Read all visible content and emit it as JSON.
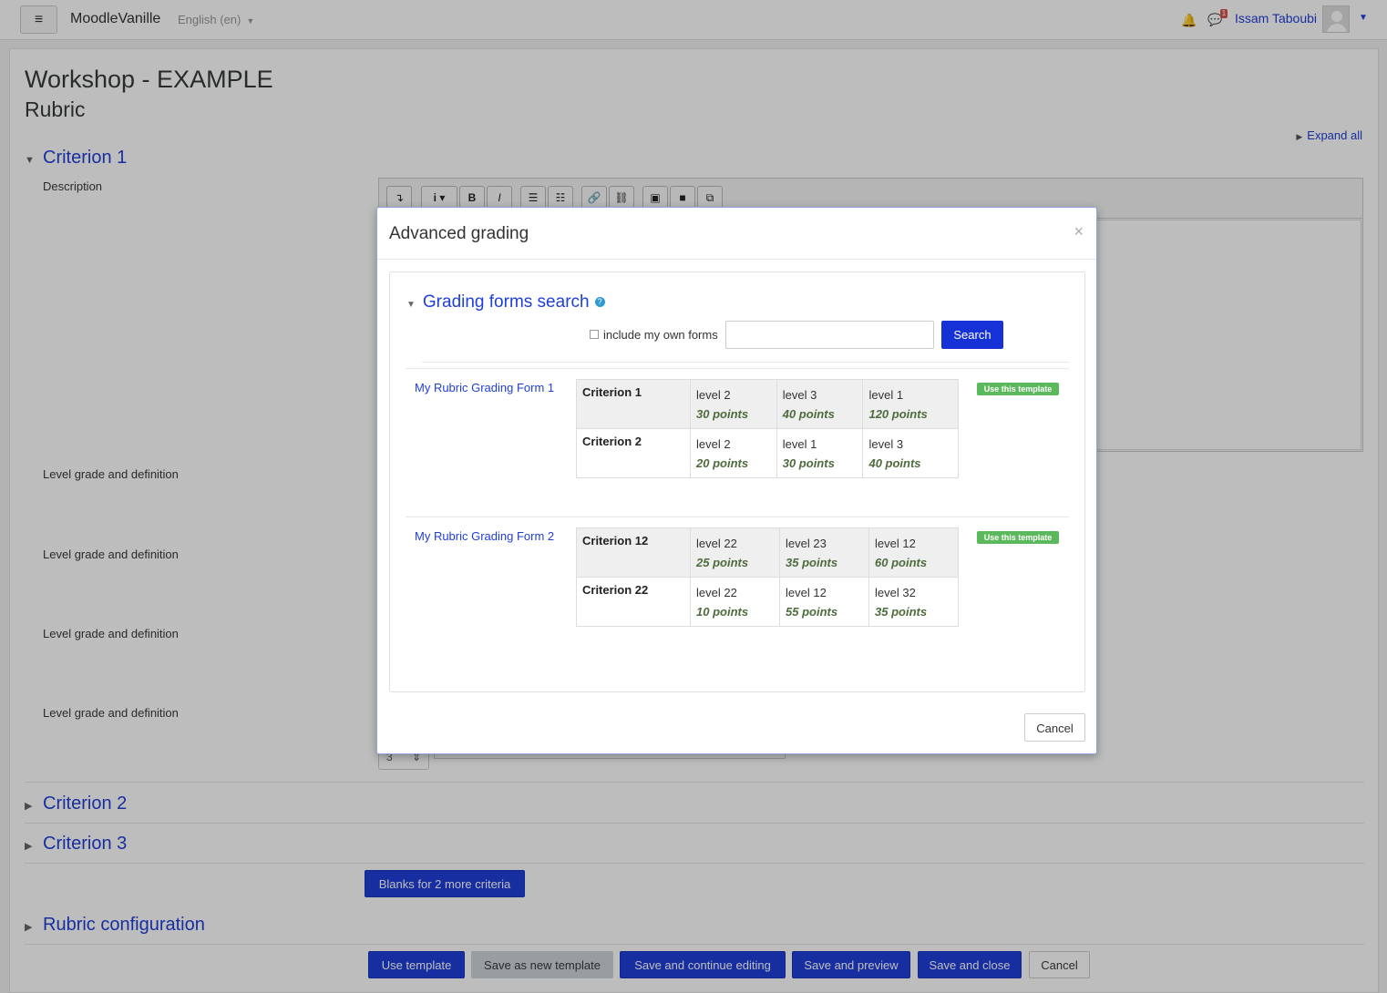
{
  "navbar": {
    "site_name": "MoodleVanille",
    "language": "English (en)",
    "user_name": "Issam Taboubi",
    "message_count": "1"
  },
  "page": {
    "title": "Workshop - EXAMPLE",
    "subtitle": "Rubric",
    "expand_all": "Expand all"
  },
  "criteria": {
    "c1": "Criterion 1",
    "c2": "Criterion 2",
    "c3": "Criterion 3",
    "description_label": "Description",
    "level_label": "Level grade and definition",
    "level_select_value": "3"
  },
  "rubric_config": "Rubric configuration",
  "buttons": {
    "blanks": "Blanks for 2 more criteria",
    "use_template": "Use template",
    "save_new_template": "Save as new template",
    "save_continue": "Save and continue editing",
    "save_preview": "Save and preview",
    "save_close": "Save and close",
    "cancel": "Cancel"
  },
  "modal": {
    "title": "Advanced grading",
    "close": "×",
    "search_heading": "Grading forms search",
    "include_own": "include my own forms",
    "search_placeholder": "",
    "search_button": "Search",
    "use_template_badge": "Use this template",
    "cancel": "Cancel",
    "forms": [
      {
        "name": "My Rubric Grading Form 1",
        "rows": [
          {
            "criterion": "Criterion 1",
            "levels": [
              {
                "level": "level 2",
                "points": "30 points"
              },
              {
                "level": "level 3",
                "points": "40 points"
              },
              {
                "level": "level 1",
                "points": "120 points"
              }
            ]
          },
          {
            "criterion": "Criterion 2",
            "levels": [
              {
                "level": "level 2",
                "points": "20 points"
              },
              {
                "level": "level 1",
                "points": "30 points"
              },
              {
                "level": "level 3",
                "points": "40 points"
              }
            ]
          }
        ]
      },
      {
        "name": "My Rubric Grading Form 2",
        "rows": [
          {
            "criterion": "Criterion 12",
            "levels": [
              {
                "level": "level 22",
                "points": "25 points"
              },
              {
                "level": "level 23",
                "points": "35 points"
              },
              {
                "level": "level 12",
                "points": "60 points"
              }
            ]
          },
          {
            "criterion": "Criterion 22",
            "levels": [
              {
                "level": "level 22",
                "points": "10 points"
              },
              {
                "level": "level 12",
                "points": "55 points"
              },
              {
                "level": "level 32",
                "points": "35 points"
              }
            ]
          }
        ]
      }
    ]
  }
}
